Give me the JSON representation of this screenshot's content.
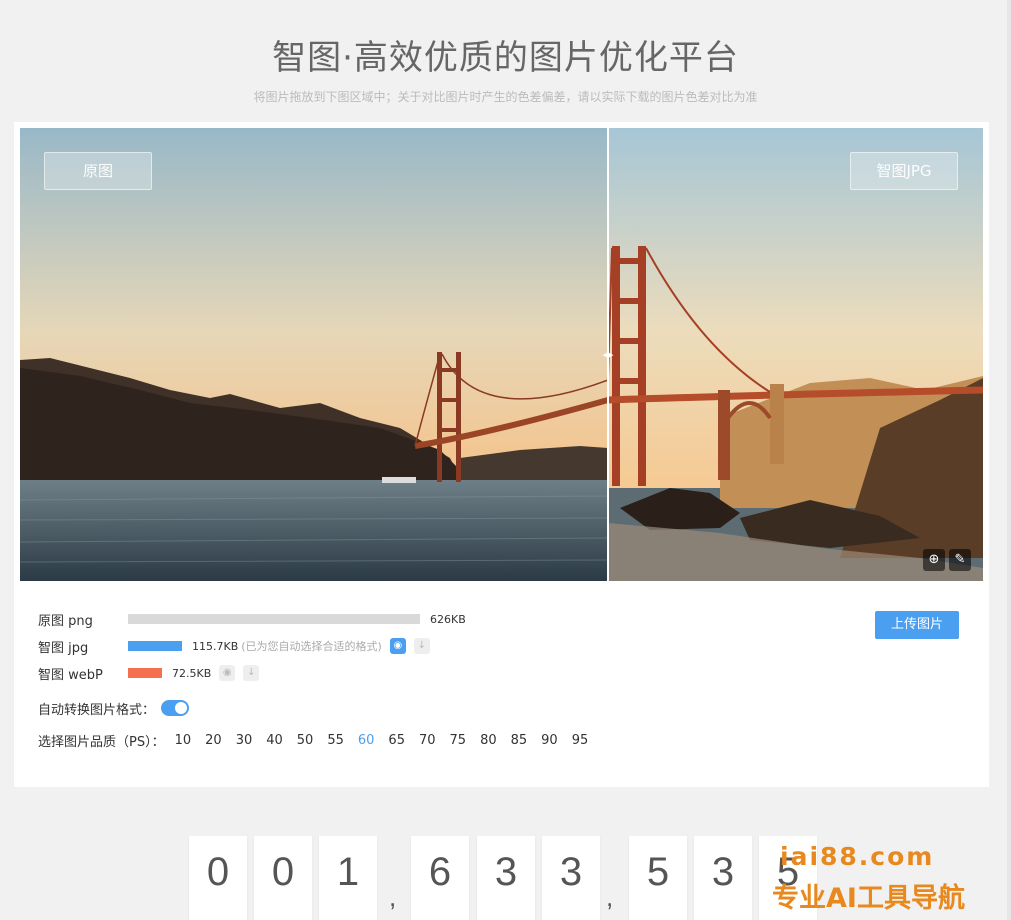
{
  "header": {
    "title": "智图·高效优质的图片优化平台",
    "subtitle": "将图片拖放到下图区域中；关于对比图片时产生的色差偏差，请以实际下载的图片色差对比为准"
  },
  "compare": {
    "left_label": "原图",
    "right_label": "智图JPG",
    "zoom_icon": "zoom-in-icon",
    "picker_icon": "color-picker-icon"
  },
  "files": [
    {
      "label": "原图 png",
      "size": "626KB",
      "color": "#d9d9d9",
      "fraction": 1.0
    },
    {
      "label": "智图 jpg",
      "size": "115.7KB",
      "note": "(已为您自动选择合适的格式)",
      "color": "#4a9ff0",
      "fraction": 0.185
    },
    {
      "label": "智图 webP",
      "size": "72.5KB",
      "color": "#f5704f",
      "fraction": 0.116
    }
  ],
  "upload_button": "上传图片",
  "auto_convert": {
    "label": "自动转换图片格式：",
    "enabled": true
  },
  "quality": {
    "label": "选择图片品质（PS）：",
    "options": [
      "10",
      "20",
      "30",
      "40",
      "50",
      "55",
      "60",
      "65",
      "70",
      "75",
      "80",
      "85",
      "90",
      "95"
    ],
    "selected": "60"
  },
  "counter": {
    "digits": [
      "0",
      "0",
      "1",
      "6",
      "3",
      "3",
      "5",
      "3",
      "5"
    ],
    "separator": ","
  },
  "watermark": {
    "line1": "iai88.com",
    "line2": "专业AI工具导航"
  }
}
